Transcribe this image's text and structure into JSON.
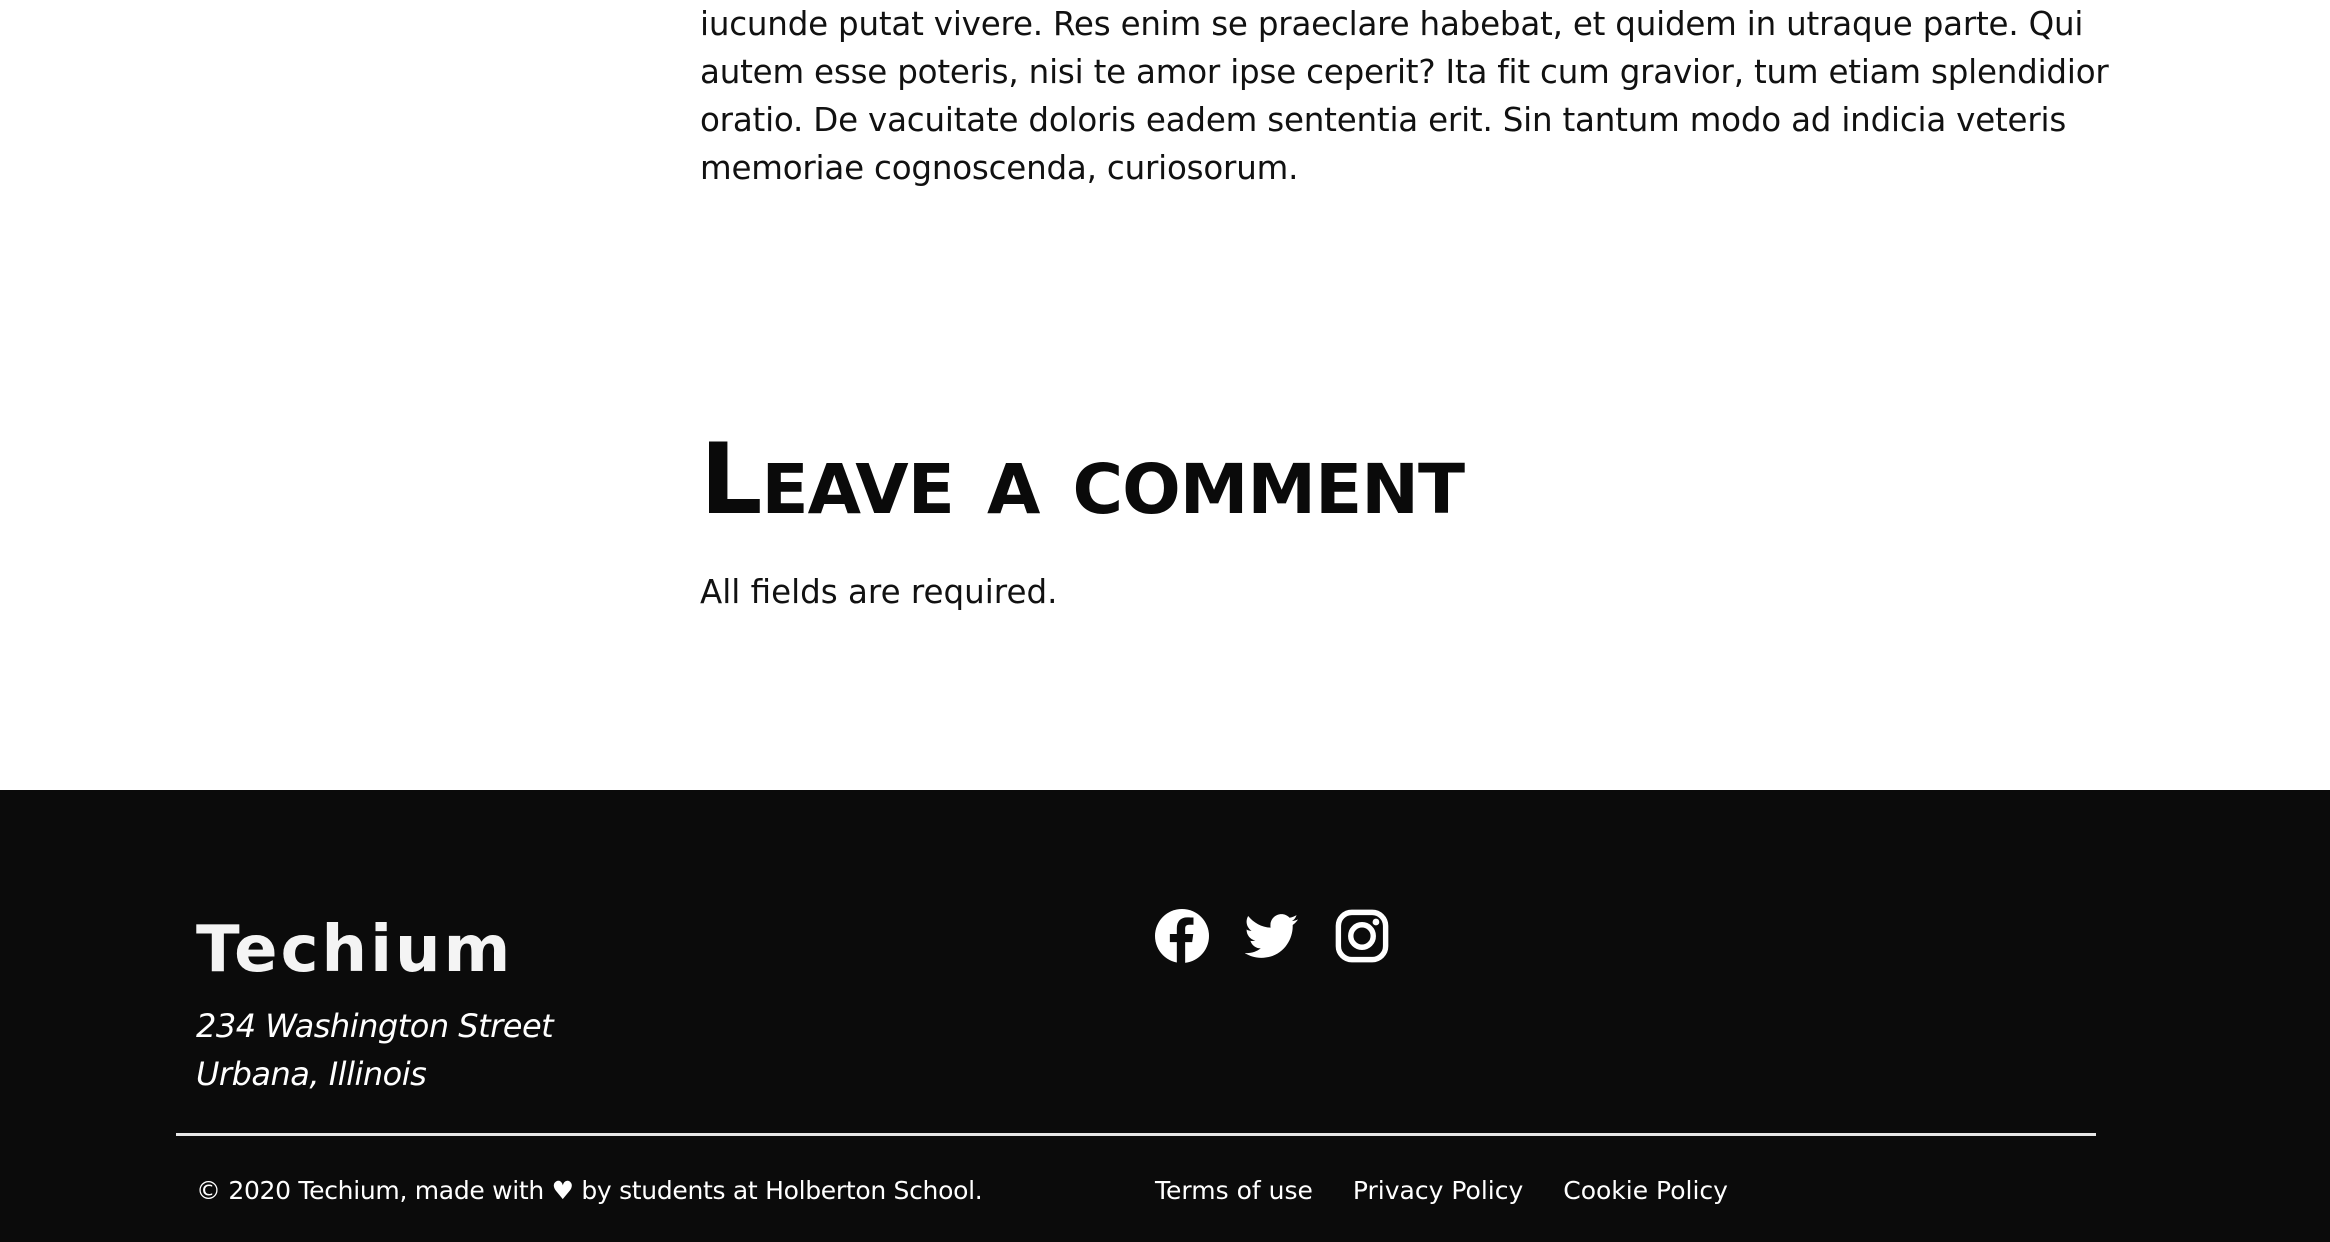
{
  "article": {
    "paragraph": "iucunde putat vivere. Res enim se praeclare habebat, et quidem in utraque parte. Qui autem esse poteris, nisi te amor ipse ceperit? Ita fit cum gravior, tum etiam splendidior oratio. De vacuitate doloris eadem sententia erit. Sin tantum modo ad indicia veteris memoriae cognoscenda, curiosorum."
  },
  "comments": {
    "title": "Leave a comment",
    "note": "All fields are required."
  },
  "footer": {
    "brand": "Techium",
    "address": {
      "line1": "234 Washington Street",
      "line2": "Urbana, Illinois"
    },
    "social": [
      {
        "name": "facebook",
        "icon": "facebook-icon"
      },
      {
        "name": "twitter",
        "icon": "twitter-icon"
      },
      {
        "name": "instagram",
        "icon": "instagram-icon"
      }
    ],
    "copyright": "© 2020 Techium, made with ♥ by students at Holberton School.",
    "links": {
      "terms": "Terms of use",
      "privacy": "Privacy Policy",
      "cookie": "Cookie Policy"
    }
  },
  "colors": {
    "footer_background": "#0b0b0b",
    "page_background": "#ffffff",
    "text": "#111111"
  }
}
